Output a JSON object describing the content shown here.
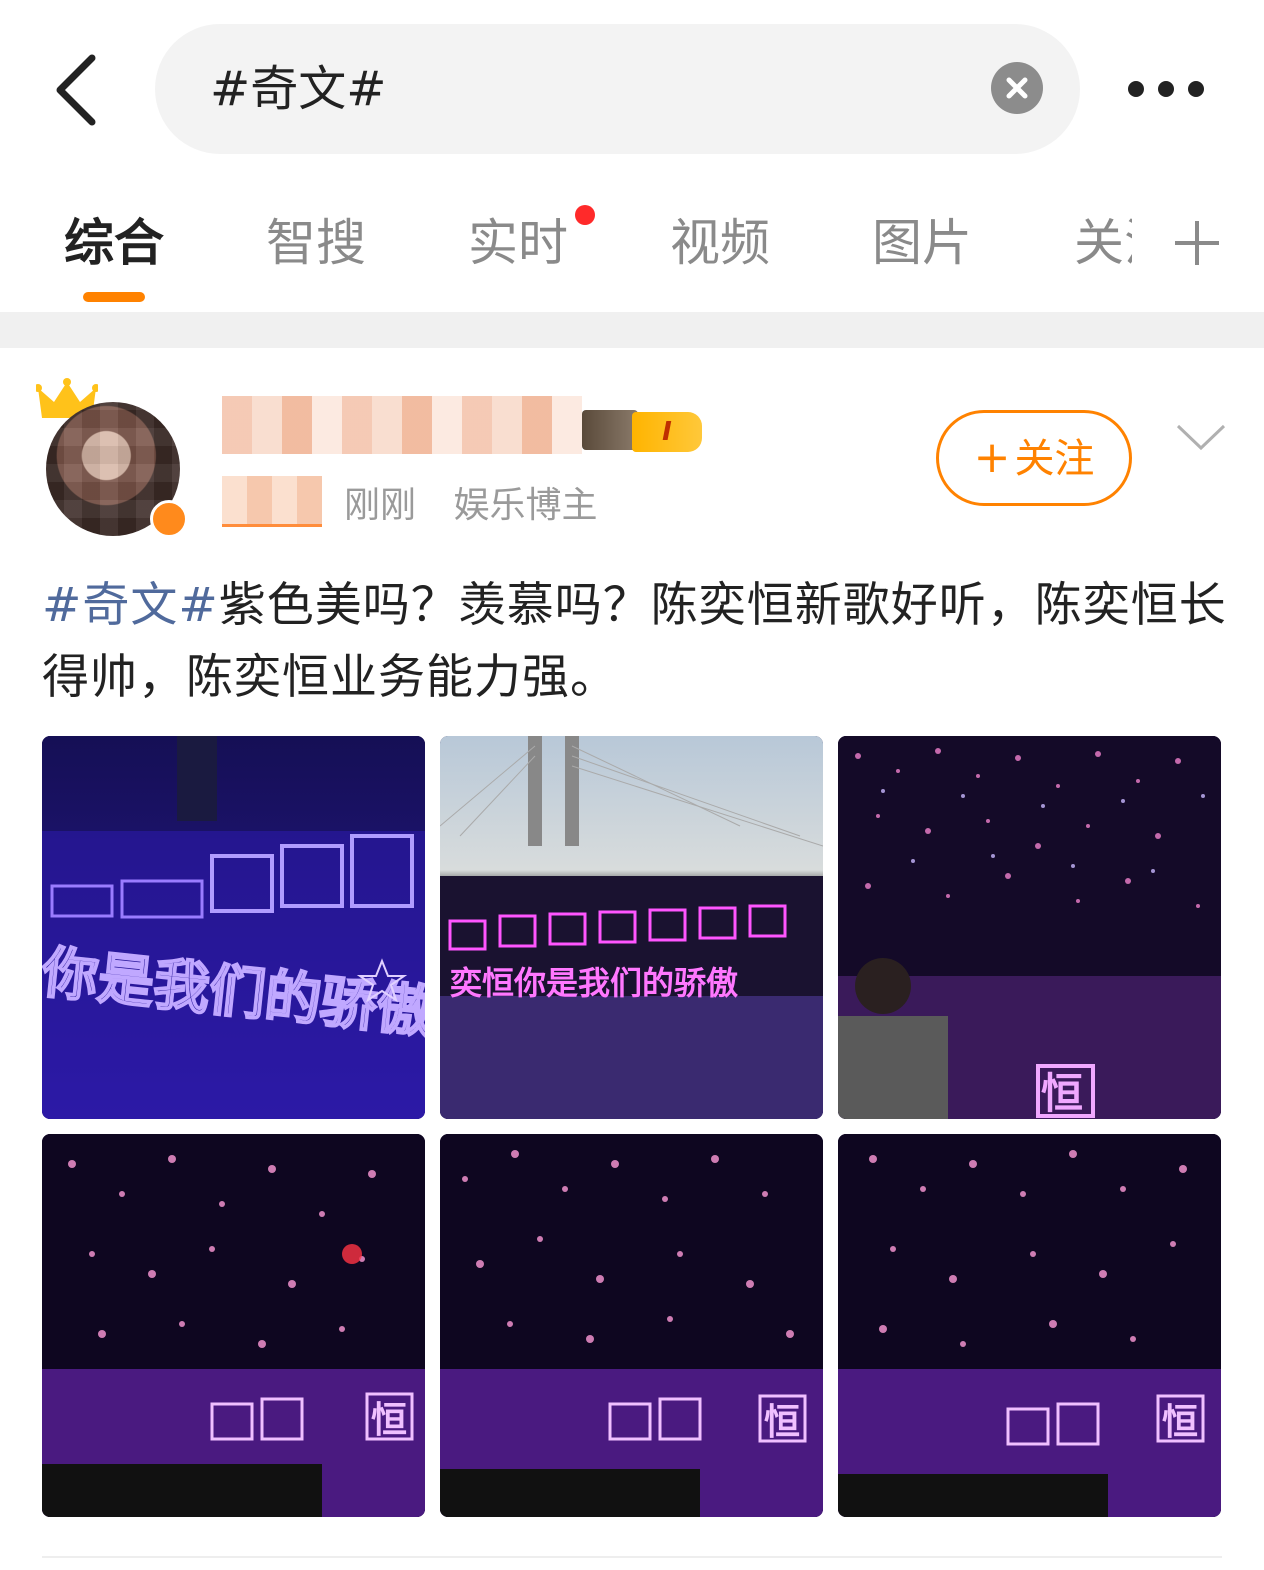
{
  "search": {
    "query": "#奇文#"
  },
  "tabs": [
    {
      "label": "综合",
      "active": true
    },
    {
      "label": "智搜",
      "active": false
    },
    {
      "label": "实时",
      "active": false,
      "has_dot": true
    },
    {
      "label": "视频",
      "active": false
    },
    {
      "label": "图片",
      "active": false
    },
    {
      "label": "关注",
      "active": false
    }
  ],
  "post": {
    "author_level": "I",
    "time": "刚刚",
    "source": "娱乐博主",
    "follow_label": "关注",
    "hashtag": "#奇文#",
    "body": "紫色美吗？羡慕吗？陈奕恒新歌好听，陈奕恒长得帅，陈奕恒业务能力强。",
    "photos": [
      {
        "id": "photo-1",
        "caption": "你是我们的骄傲"
      },
      {
        "id": "photo-2",
        "caption": "奕恒你是我们的骄傲"
      },
      {
        "id": "photo-3",
        "caption": "恒"
      },
      {
        "id": "photo-4",
        "caption": "恒"
      },
      {
        "id": "photo-5",
        "caption": "恒"
      },
      {
        "id": "photo-6",
        "caption": "恒"
      }
    ]
  },
  "colors": {
    "accent": "#ff8200",
    "link": "#506a9c",
    "notification_dot": "#ff2a2a",
    "separator": "#f0f0f0"
  }
}
